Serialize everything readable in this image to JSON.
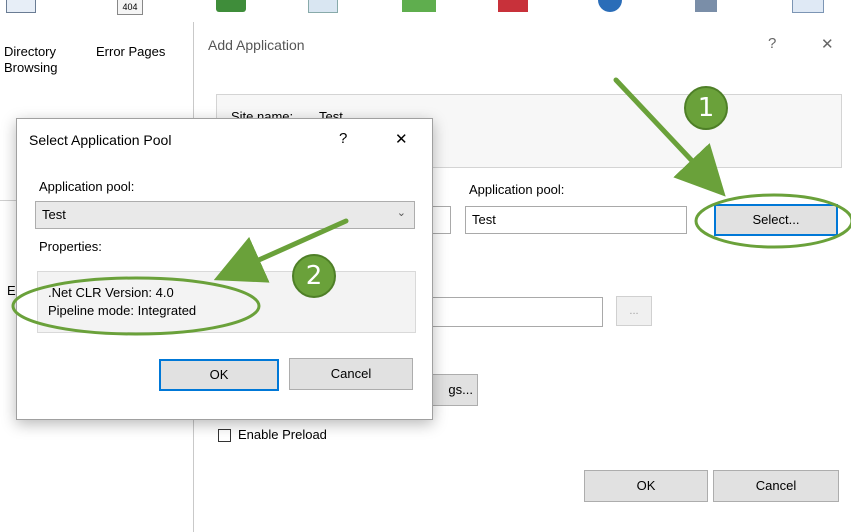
{
  "iis_features": {
    "directory_browsing": "Directory\nBrowsing",
    "error_pages": "Error Pages",
    "error_pages_icon_text": "404"
  },
  "add_application": {
    "title": "Add Application",
    "help_glyph": "?",
    "close_glyph": "✕",
    "site_name_label": "Site name:",
    "site_name_value": "Test",
    "app_pool_label": "Application pool:",
    "app_pool_value": "Test",
    "select_button": "Select...",
    "browse_button": "...",
    "settings_button_partial": "gs...",
    "enable_preload_label": "Enable Preload",
    "ok_button": "OK",
    "cancel_button": "Cancel"
  },
  "select_pool": {
    "title": "Select Application Pool",
    "help_glyph": "?",
    "close_glyph": "✕",
    "pool_label": "Application pool:",
    "pool_value": "Test",
    "properties_label": "Properties:",
    "clr_version": ".Net CLR Version: 4.0",
    "pipeline_mode": "Pipeline mode: Integrated",
    "ok_button": "OK",
    "cancel_button": "Cancel"
  },
  "annotations": {
    "step1": "1",
    "step2": "2",
    "color": "#6aa13a"
  }
}
